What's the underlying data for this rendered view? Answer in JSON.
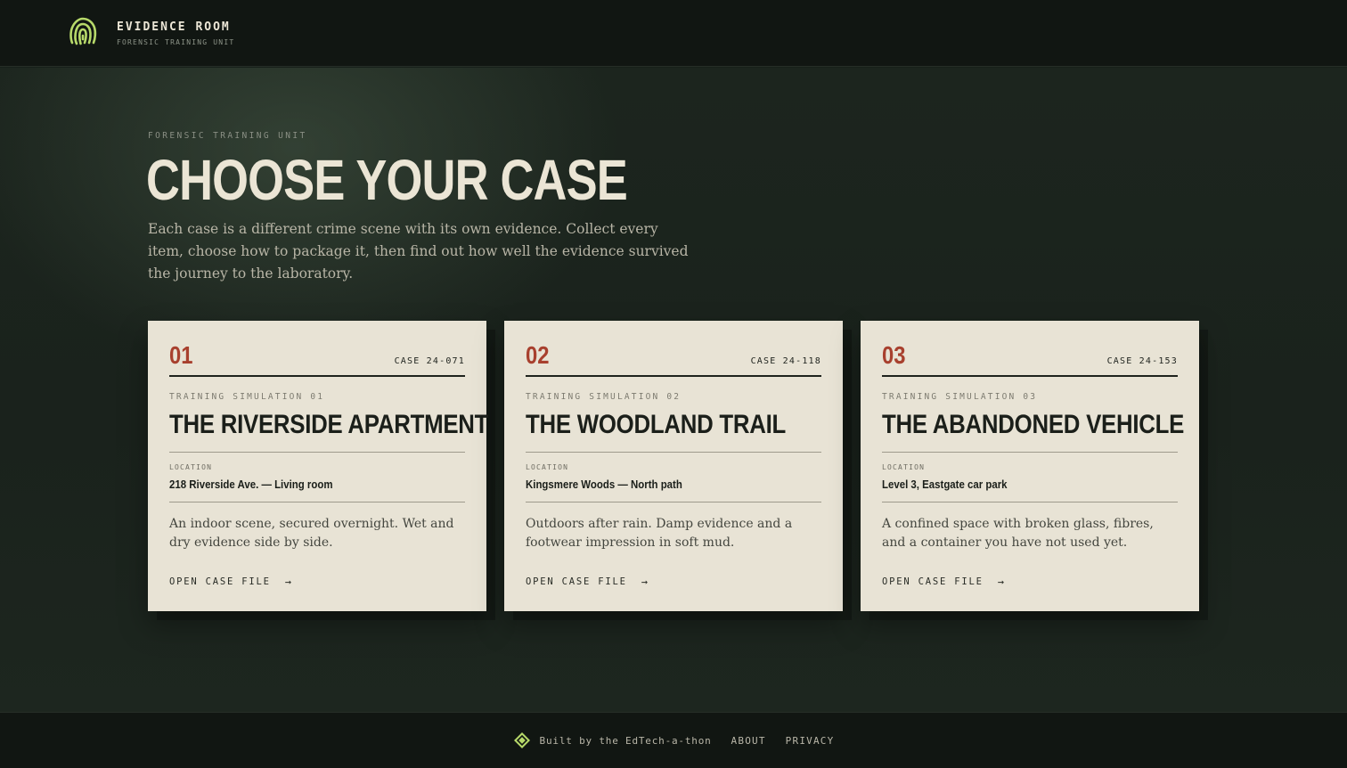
{
  "header": {
    "title": "EVIDENCE ROOM",
    "subtitle": "FORENSIC TRAINING UNIT",
    "logo_icon": "fingerprint-icon",
    "accent_color": "#b7d96a"
  },
  "hero": {
    "eyebrow": "FORENSIC TRAINING UNIT",
    "headline": "CHOOSE YOUR CASE",
    "intro": "Each case is a different crime scene with its own evidence. Collect every item, choose how to package it, then find out how well the evidence survived the journey to the laboratory."
  },
  "cases": [
    {
      "number": "01",
      "case_id": "CASE 24-071",
      "simulation": "TRAINING SIMULATION 01",
      "title": "THE RIVERSIDE APARTMENT",
      "location_label": "LOCATION",
      "location": "218 Riverside Ave. — Living room",
      "description": "An indoor scene, secured overnight. Wet and dry evidence side by side.",
      "link_label": "OPEN CASE FILE",
      "link_icon": "→"
    },
    {
      "number": "02",
      "case_id": "CASE 24-118",
      "simulation": "TRAINING SIMULATION 02",
      "title": "THE WOODLAND TRAIL",
      "location_label": "LOCATION",
      "location": "Kingsmere Woods — North path",
      "description": "Outdoors after rain. Damp evidence and a footwear impression in soft mud.",
      "link_label": "OPEN CASE FILE",
      "link_icon": "→"
    },
    {
      "number": "03",
      "case_id": "CASE 24-153",
      "simulation": "TRAINING SIMULATION 03",
      "title": "THE ABANDONED VEHICLE",
      "location_label": "LOCATION",
      "location": "Level 3, Eastgate car park",
      "description": "A confined space with broken glass, fibres, and a container you have not used yet.",
      "link_label": "OPEN CASE FILE",
      "link_icon": "→"
    }
  ],
  "footer": {
    "icon": "edtech-logo-icon",
    "built_by": "Built by the EdTech-a-thon",
    "links": [
      "ABOUT",
      "PRIVACY"
    ]
  }
}
